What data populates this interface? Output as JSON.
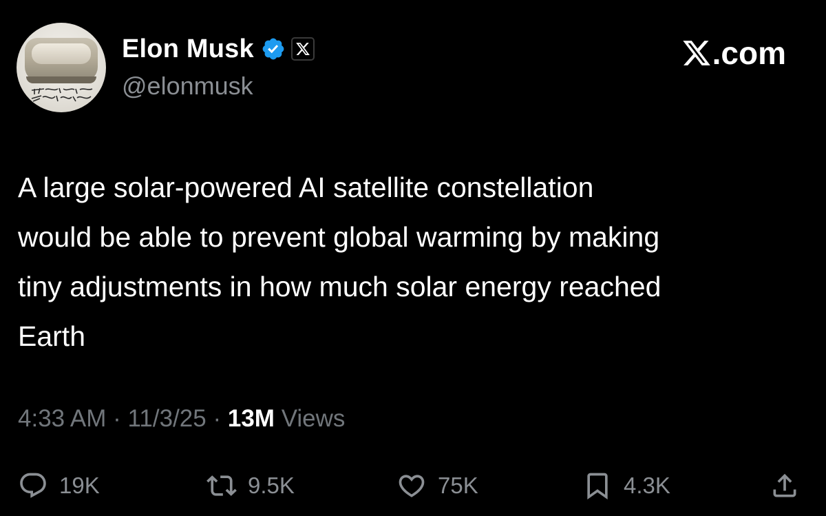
{
  "brand": {
    "label": ".com",
    "logo_icon": "x-logo-icon"
  },
  "author": {
    "display_name": "Elon Musk",
    "handle": "@elonmusk",
    "verified_icon": "verified-badge-icon",
    "affiliation_icon": "x-affiliation-icon",
    "avatar_icon": "avatar-cybertruck"
  },
  "tweet": {
    "text_lines": [
      "A large solar-powered AI satellite constellation",
      "would be able to prevent global warming by making",
      "tiny adjustments in how much solar energy reached",
      "Earth"
    ]
  },
  "meta": {
    "time": "4:33 AM",
    "separator": "·",
    "date": "11/3/25",
    "views_count": "13M",
    "views_label": "Views"
  },
  "actions": {
    "reply": {
      "count": "19K",
      "icon": "reply-icon"
    },
    "repost": {
      "count": "9.5K",
      "icon": "repost-icon"
    },
    "like": {
      "count": "75K",
      "icon": "heart-icon"
    },
    "bookmark": {
      "count": "4.3K",
      "icon": "bookmark-icon"
    },
    "share": {
      "icon": "share-icon"
    }
  },
  "colors": {
    "background": "#000000",
    "text_primary": "#ffffff",
    "text_secondary": "#71767b",
    "verified_blue": "#1d9bf0"
  }
}
